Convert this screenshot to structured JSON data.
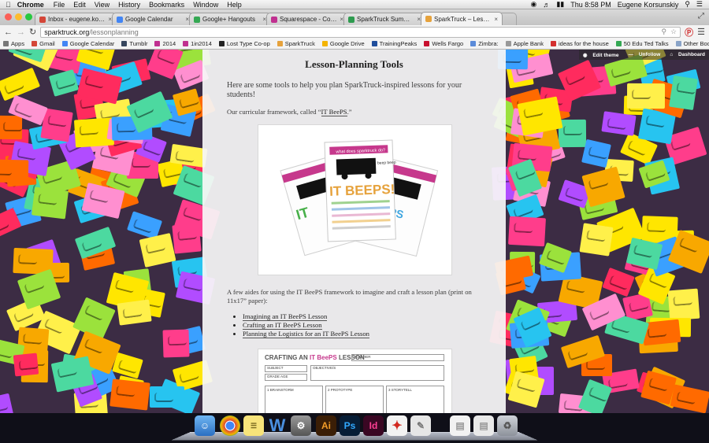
{
  "menubar": {
    "app": "Chrome",
    "menus": [
      "File",
      "Edit",
      "View",
      "History",
      "Bookmarks",
      "Window",
      "Help"
    ],
    "clock": "Thu 8:58 PM",
    "user": "Eugene Korsunskiy"
  },
  "tabs": [
    {
      "title": "Inbox - eugene.korsunskiy",
      "color": "#d44638"
    },
    {
      "title": "Google Calendar",
      "color": "#4285f4"
    },
    {
      "title": "Google+ Hangouts",
      "color": "#34a853"
    },
    {
      "title": "Squarespace - Configuratio",
      "color": "#c03090"
    },
    {
      "title": "SparkTruck Summer Progr",
      "color": "#2e9b4f"
    },
    {
      "title": "SparkTruck – Lesson-Plann",
      "color": "#e6a23c",
      "active": true
    }
  ],
  "url": {
    "host": "sparktruck.org",
    "path": "/lessonplanning"
  },
  "bookmarks": [
    {
      "label": "Apps",
      "color": "#777"
    },
    {
      "label": "Gmail",
      "color": "#d44638"
    },
    {
      "label": "Google Calendar",
      "color": "#4285f4"
    },
    {
      "label": "Tumblr",
      "color": "#36465d"
    },
    {
      "label": "2014",
      "color": "#c03090"
    },
    {
      "label": "1in2014",
      "color": "#c03090"
    },
    {
      "label": "Lost Type Co-op",
      "color": "#222"
    },
    {
      "label": "SparkTruck",
      "color": "#e6a23c"
    },
    {
      "label": "Google Drive",
      "color": "#f4b400"
    },
    {
      "label": "TrainingPeaks",
      "color": "#1f4e9c"
    },
    {
      "label": "Wells Fargo",
      "color": "#c8102e"
    },
    {
      "label": "Zimbra:",
      "color": "#5b8bd9"
    },
    {
      "label": "Apple Bank",
      "color": "#999"
    },
    {
      "label": "ideas for the house",
      "color": "#d32f2f"
    },
    {
      "label": "50 Edu Ted Talks",
      "color": "#34a853"
    }
  ],
  "other_bookmarks": "Other Bookmarks",
  "squarespace": {
    "edit": "Edit theme",
    "unfollow": "Unfollow",
    "dashboard": "Dashboard"
  },
  "content": {
    "title": "Lesson-Planning Tools",
    "intro": "Here are some tools to help you plan SparkTruck-inspired lessons for your students!",
    "framework_prefix": "Our curricular framework, called “",
    "framework_link": "IT BeePS",
    "framework_suffix": ".”",
    "aides": "A few aides for using the IT BeePS framework to imagine and craft a lesson plan (print on 11x17” paper):",
    "links": [
      "Imagining an IT BeePS Lesson",
      "Crafting an IT BeePS Lesson",
      "Planning the Logistics for an IT BeePS Lesson"
    ]
  },
  "poster": {
    "banner": "what does sparktruck do?",
    "big": "IT BEEPS!",
    "beep": "beep beep"
  },
  "worksheet": {
    "title_a": "CRAFTING AN ",
    "title_b": "IT BeePS",
    "title_c": " LESSON",
    "teacher": "TEACHER",
    "subject": "SUBJECT",
    "objectives": "OBJECTIVE/S",
    "grade": "GRADE AGE",
    "steps": [
      "BRAINSTORM",
      "PROTOTYPE",
      "STORYTELL"
    ]
  },
  "dock_icons": [
    "finder",
    "chrome",
    "stickies",
    "word",
    "photos",
    "illustrator",
    "photoshop",
    "indesign",
    "acrobat",
    "preview",
    "documents",
    "files",
    "trash"
  ]
}
